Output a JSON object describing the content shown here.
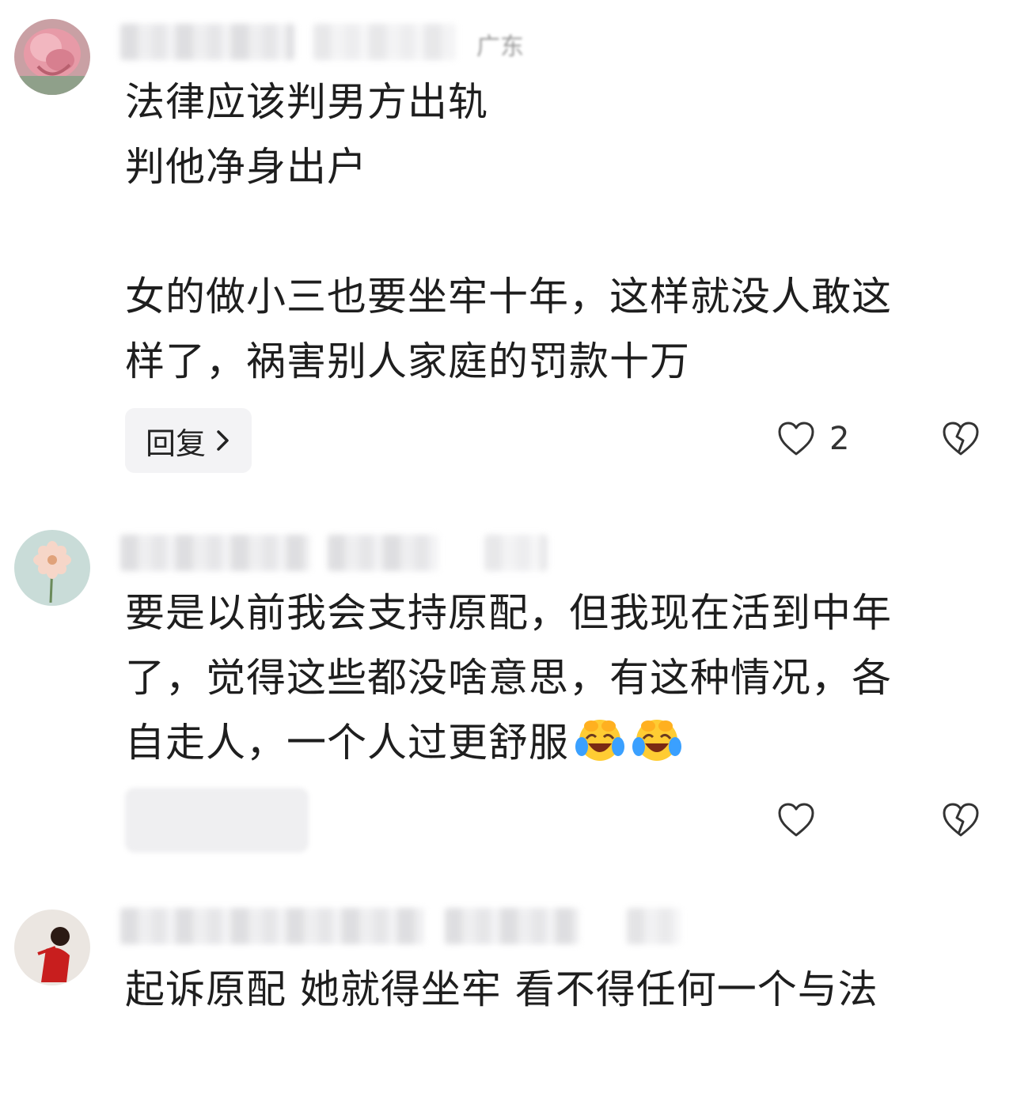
{
  "comments": [
    {
      "meta_location": "广东",
      "lines": [
        "法律应该判男方出轨",
        "判他净身出户",
        "",
        "女的做小三也要坐牢十年，这样就没人敢这",
        "样了，祸害别人家庭的罚款十万"
      ],
      "reply_label": "回复",
      "like_count": "2"
    },
    {
      "lines": [
        "要是以前我会支持原配，但我现在活到中年",
        "了，觉得这些都没啥意思，有这种情况，各",
        "自走人，一个人过更舒服"
      ],
      "emojis": [
        "laugh-cry-emoji",
        "laugh-cry-emoji"
      ]
    },
    {
      "lines": [
        "起诉原配 她就得坐牢 看不得任何一个与法"
      ]
    }
  ],
  "colors": {
    "background": "#ffffff",
    "text": "#1e1e1e",
    "icon": "#333333",
    "reply_bg": "#f3f3f5"
  }
}
